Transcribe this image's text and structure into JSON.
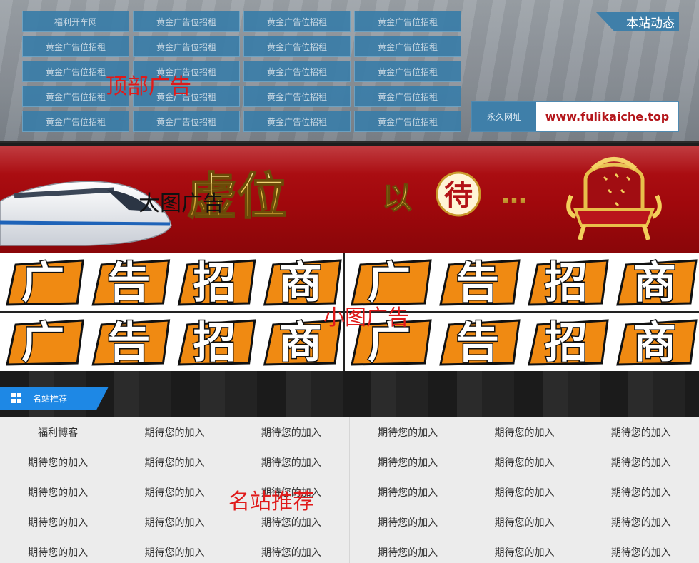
{
  "top_ads": {
    "cells": [
      "福利开车网",
      "黄金广告位招租",
      "黄金广告位招租",
      "黄金广告位招租",
      "黄金广告位招租",
      "黄金广告位招租",
      "黄金广告位招租",
      "黄金广告位招租",
      "黄金广告位招租",
      "黄金广告位招租",
      "黄金广告位招租",
      "黄金广告位招租",
      "黄金广告位招租",
      "黄金广告位招租",
      "黄金广告位招租",
      "黄金广告位招租",
      "黄金广告位招租",
      "黄金广告位招租",
      "黄金广告位招租",
      "黄金广告位招租"
    ],
    "overlay_label": "顶部广告"
  },
  "site_news": {
    "tab_label": "本站动态",
    "permanent_label": "永久网址",
    "permanent_url": "www.fulikaiche.top"
  },
  "big_banner": {
    "headline_part1": "虚位",
    "headline_part2": "以",
    "headline_part3": "待",
    "headline_ellipsis": "…",
    "overlay_label": "大图广告"
  },
  "small_ads": {
    "items": [
      {
        "chars": [
          "广",
          "告",
          "招",
          "商"
        ]
      },
      {
        "chars": [
          "广",
          "告",
          "招",
          "商"
        ]
      },
      {
        "chars": [
          "广",
          "告",
          "招",
          "商"
        ]
      },
      {
        "chars": [
          "广",
          "告",
          "招",
          "商"
        ]
      }
    ],
    "overlay_label": "小图广告"
  },
  "recommended": {
    "title": "名站推荐",
    "cells": [
      "福利博客",
      "期待您的加入",
      "期待您的加入",
      "期待您的加入",
      "期待您的加入",
      "期待您的加入",
      "期待您的加入",
      "期待您的加入",
      "期待您的加入",
      "期待您的加入",
      "期待您的加入",
      "期待您的加入",
      "期待您的加入",
      "期待您的加入",
      "期待您的加入",
      "期待您的加入",
      "期待您的加入",
      "期待您的加入",
      "期待您的加入",
      "期待您的加入",
      "期待您的加入",
      "期待您的加入",
      "期待您的加入",
      "期待您的加入",
      "期待您的加入",
      "期待您的加入",
      "期待您的加入",
      "期待您的加入",
      "期待您的加入",
      "期待您的加入"
    ],
    "overlay_label": "名站推荐"
  },
  "colors": {
    "ad_cell_bg": "#3a7da8",
    "banner_red": "#a0080c",
    "gold": "#e2b43c",
    "orange": "#f08a12",
    "accent_blue": "#1e88e5",
    "overlay_red": "#e01a1a"
  },
  "icons": {
    "train": "train-icon",
    "throne": "throne-icon",
    "grid": "grid-icon"
  }
}
